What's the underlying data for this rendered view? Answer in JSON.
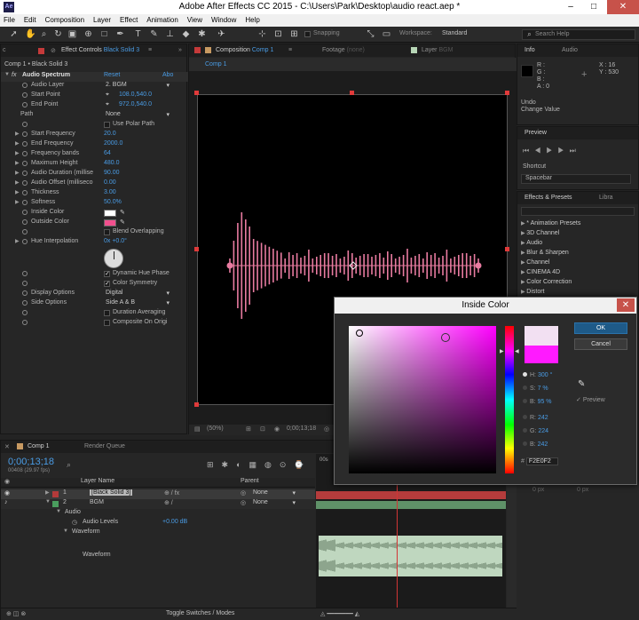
{
  "window": {
    "title": "Adobe After Effects CC 2015 - C:\\Users\\Park\\Desktop\\audio react.aep *",
    "app_icon": "Ae",
    "minimize": "–",
    "maximize": "□",
    "close": "✕"
  },
  "menu": [
    "File",
    "Edit",
    "Composition",
    "Layer",
    "Effect",
    "Animation",
    "View",
    "Window",
    "Help"
  ],
  "toolbar": {
    "snapping": "Snapping",
    "workspace_label": "Workspace:",
    "workspace_value": "Standard",
    "search_placeholder": "Search Help"
  },
  "effect_controls": {
    "tab_label": "Effect Controls",
    "tab_layer": "Black Solid 3",
    "breadcrumb": "Comp 1 • Black Solid 3",
    "effect_name": "Audio Spectrum",
    "reset": "Reset",
    "about": "Abo",
    "props": [
      {
        "name": "Audio Layer",
        "value": "2. BGM",
        "kind": "dropdown"
      },
      {
        "name": "Start Point",
        "value": "108.0,540.0",
        "kind": "point"
      },
      {
        "name": "End Point",
        "value": "972.0,540.0",
        "kind": "point"
      },
      {
        "name": "Path",
        "value": "None",
        "kind": "dropdown"
      },
      {
        "name": "",
        "value": "Use Polar Path",
        "kind": "check",
        "checked": false
      },
      {
        "name": "Start Frequency",
        "value": "20.0",
        "kind": "num"
      },
      {
        "name": "End Frequency",
        "value": "2000.0",
        "kind": "num"
      },
      {
        "name": "Frequency bands",
        "value": "64",
        "kind": "num"
      },
      {
        "name": "Maximum Height",
        "value": "480.0",
        "kind": "num"
      },
      {
        "name": "Audio Duration (millise",
        "value": "90.00",
        "kind": "num"
      },
      {
        "name": "Audio Offset (milliseco",
        "value": "0.00",
        "kind": "num"
      },
      {
        "name": "Thickness",
        "value": "3.00",
        "kind": "num"
      },
      {
        "name": "Softness",
        "value": "50.0%",
        "kind": "num"
      },
      {
        "name": "Inside Color",
        "value": "",
        "kind": "color",
        "color": "#ffffff"
      },
      {
        "name": "Outside Color",
        "value": "",
        "kind": "color",
        "color": "#f2508e"
      },
      {
        "name": "",
        "value": "Blend Overlapping",
        "kind": "check",
        "checked": false
      },
      {
        "name": "Hue Interpolation",
        "value": "0x +0.0°",
        "kind": "num"
      }
    ],
    "props2": [
      {
        "name": "",
        "value": "Dynamic Hue Phase",
        "kind": "check",
        "checked": true
      },
      {
        "name": "",
        "value": "Color Symmetry",
        "kind": "check",
        "checked": true
      },
      {
        "name": "Display Options",
        "value": "Digital",
        "kind": "dropdown"
      },
      {
        "name": "Side Options",
        "value": "Side A & B",
        "kind": "dropdown"
      },
      {
        "name": "",
        "value": "Duration Averaging",
        "kind": "check",
        "checked": false
      },
      {
        "name": "",
        "value": "Composite On Origi",
        "kind": "check",
        "checked": false
      }
    ]
  },
  "composition": {
    "tab_comp_label": "Composition",
    "tab_comp_name": "Comp 1",
    "tab_footage": "Footage",
    "tab_footage_val": "(none)",
    "tab_layer": "Layer",
    "tab_layer_val": "BGM",
    "sub_tab": "Comp 1",
    "zoom": "(50%)",
    "timecode": "0;00;13;18",
    "waveform_color": "#e87ba0"
  },
  "info": {
    "tab_info": "Info",
    "tab_audio": "Audio",
    "r": "R :",
    "g": "G :",
    "b": "B :",
    "a": "A : 0",
    "x": "X : 16",
    "y": "Y : 530",
    "undo": "Undo",
    "undo_action": "Change Value"
  },
  "preview": {
    "tab": "Preview",
    "shortcut_label": "Shortcut",
    "shortcut_value": "Spacebar"
  },
  "effects_presets": {
    "tab": "Effects & Presets",
    "tab2": "Libra",
    "items": [
      "* Animation Presets",
      "3D Channel",
      "Audio",
      "Blur & Sharpen",
      "Channel",
      "CINEMA 4D",
      "Color Correction",
      "Distort"
    ]
  },
  "color_dialog": {
    "title": "Inside Color",
    "ok": "OK",
    "cancel": "Cancel",
    "preview": "Preview",
    "h_label": "H:",
    "h_value": "300 °",
    "s_label": "S:",
    "s_value": "7 %",
    "b_label": "B:",
    "b_value": "95 %",
    "r_label": "R:",
    "r_value": "242",
    "g_label": "G:",
    "g_value": "224",
    "bb_label": "B:",
    "bb_value": "242",
    "hex_label": "#",
    "hex_value": "F2E0F2",
    "new_color": "#f2e0f2",
    "old_color": "#ff1aff"
  },
  "timeline": {
    "tab_comp": "Comp 1",
    "tab_render": "Render Queue",
    "timecode": "0;00;13;18",
    "frames": "00408 (29.97 fps)",
    "col_layer_name": "Layer Name",
    "col_parent": "Parent",
    "layers": [
      {
        "num": "1",
        "name": "[Black Solid 3]",
        "parent": "None",
        "label_color": "#b33a3a"
      },
      {
        "num": "2",
        "name": "BGM",
        "parent": "None",
        "label_color": "#4a9e5e"
      }
    ],
    "audio_group": "Audio",
    "audio_levels_label": "Audio Levels",
    "audio_levels_value": "+0.00 dB",
    "waveform_group": "Waveform",
    "waveform_label": "Waveform",
    "toggle_label": "Toggle Switches / Modes",
    "ruler_start": "00s",
    "right_px1": "0 px",
    "right_px2": "0 px"
  }
}
